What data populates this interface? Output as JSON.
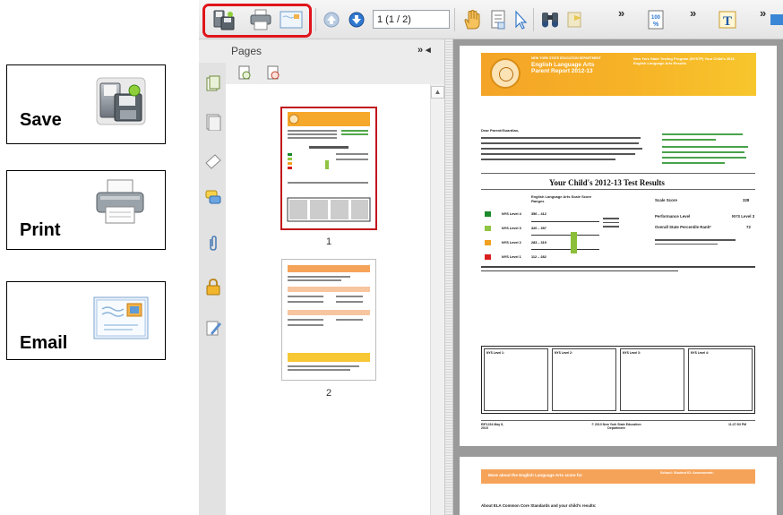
{
  "callouts": {
    "save": {
      "label": "Save",
      "icon": "save-icon"
    },
    "print": {
      "label": "Print",
      "icon": "print-icon"
    },
    "email": {
      "label": "Email",
      "icon": "email-icon"
    }
  },
  "toolbar": {
    "page_field_value": "1 (1 / 2)",
    "highlight_color": "#e0141b",
    "chevron": "»",
    "icons": [
      "save-icon",
      "print-icon",
      "email-icon",
      "page-up-icon",
      "page-down-icon",
      "hand-tool-icon",
      "select-text-icon",
      "pointer-icon",
      "find-icon",
      "flag-icon",
      "zoom-percent-icon",
      "typewriter-icon"
    ]
  },
  "pages_panel": {
    "title": "Pages",
    "head_controls": "»  ◂",
    "thumbnails": [
      {
        "number": "1",
        "selected": true
      },
      {
        "number": "2",
        "selected": false
      }
    ],
    "side_icons": [
      "pages-icon",
      "layers-icon",
      "comment-icon",
      "attachment-icon",
      "lock-icon",
      "signature-icon"
    ]
  },
  "document": {
    "page1": {
      "header_small": "NEW YORK STATE EDUCATION DEPARTMENT",
      "header_title": "English Language Arts Parent Report 2012-13",
      "header_right": "New York State Testing Program (NYSTP) Your Child's 2013 English Language Arts Results",
      "greeting": "Dear Parent/Guardian,",
      "results_title": "Your Child's 2012-13 Test Results",
      "scale_heading": "English Language Arts Scale Score Ranges",
      "scale_score_label": "Scale Score",
      "scale_score_value": "328",
      "perf_level_label": "Performance Level",
      "perf_level_value": "NYS Level 3",
      "percentile_label": "Overall State Percentile Rank*",
      "percentile_value": "72",
      "levels": [
        {
          "name": "NYS Level 4",
          "range": "356 – 412",
          "color": "#1c8a2a"
        },
        {
          "name": "NYS Level 3",
          "range": "320 – 357",
          "color": "#8fc444"
        },
        {
          "name": "NYS Level 2",
          "range": "283 – 319",
          "color": "#f0a020"
        },
        {
          "name": "NYS Level 1",
          "range": "112 – 282",
          "color": "#d81e1e"
        }
      ],
      "footer_left": "EIP1234 May 8, 2015",
      "footer_mid": "© 2013 New York State Education Department",
      "footer_right": "11:27:53 PM",
      "level_boxes": [
        "NYS Level 1:",
        "NYS Level 2:",
        "NYS Level 3:",
        "NYS Level 4:"
      ]
    },
    "page2": {
      "band_text": "More about the English Language Arts score for",
      "band_right": "School: Student ID: Assessment:",
      "subheading": "About ELA Common Core Standards and your child's results:"
    }
  }
}
